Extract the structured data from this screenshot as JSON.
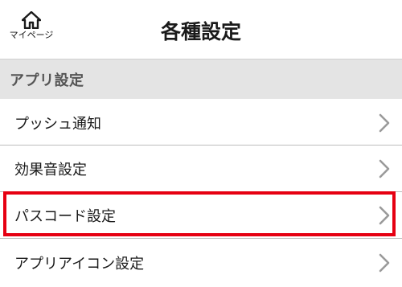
{
  "header": {
    "home_label": "マイページ",
    "home_icon": "home-icon",
    "title": "各種設定"
  },
  "section": {
    "label": "アプリ設定"
  },
  "settings": {
    "items": [
      {
        "label": "プッシュ通知",
        "icon": "chevron-right-icon"
      },
      {
        "label": "効果音設定",
        "icon": "chevron-right-icon"
      },
      {
        "label": "パスコード設定",
        "icon": "chevron-right-icon",
        "highlighted": true
      },
      {
        "label": "アプリアイコン設定",
        "icon": "chevron-right-icon"
      }
    ]
  },
  "colors": {
    "highlight_border": "#e60012",
    "section_background": "#e4e4e4",
    "chevron": "#9a9a9a"
  }
}
